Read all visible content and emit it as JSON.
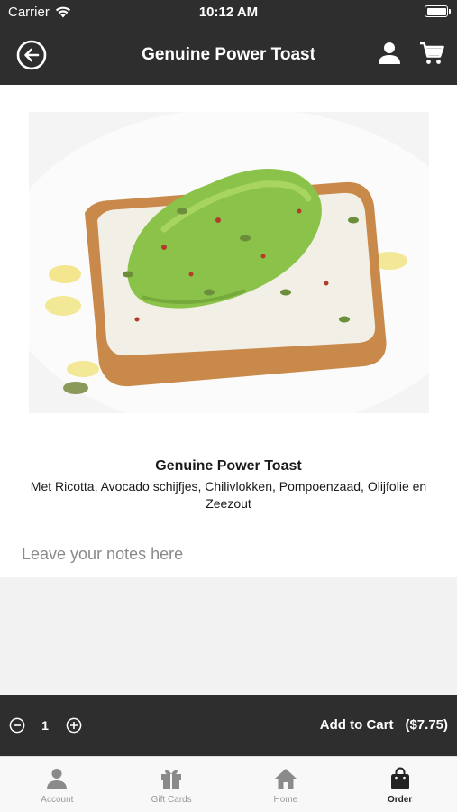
{
  "status_bar": {
    "carrier": "Carrier",
    "time": "10:12 AM"
  },
  "header": {
    "title": "Genuine Power Toast",
    "back_icon": "back-arrow-icon",
    "account_icon": "person-icon",
    "cart_icon": "cart-icon"
  },
  "product": {
    "name": "Genuine Power Toast",
    "description": "Met Ricotta, Avocado schijfjes, Chilivlokken, Pompoenzaad, Olijfolie en Zeezout",
    "notes_placeholder": "Leave your notes here",
    "notes_value": ""
  },
  "cart_bar": {
    "quantity": "1",
    "add_label": "Add to Cart",
    "price": "($7.75)"
  },
  "tabs": [
    {
      "label": "Account",
      "icon": "person-icon",
      "active": false
    },
    {
      "label": "Gift Cards",
      "icon": "gift-icon",
      "active": false
    },
    {
      "label": "Home",
      "icon": "home-icon",
      "active": false
    },
    {
      "label": "Order",
      "icon": "shopping-bag-icon",
      "active": true
    }
  ],
  "colors": {
    "bar_bg": "#2e2e2e",
    "active_tab": "#222222",
    "inactive_tab": "#999999"
  }
}
